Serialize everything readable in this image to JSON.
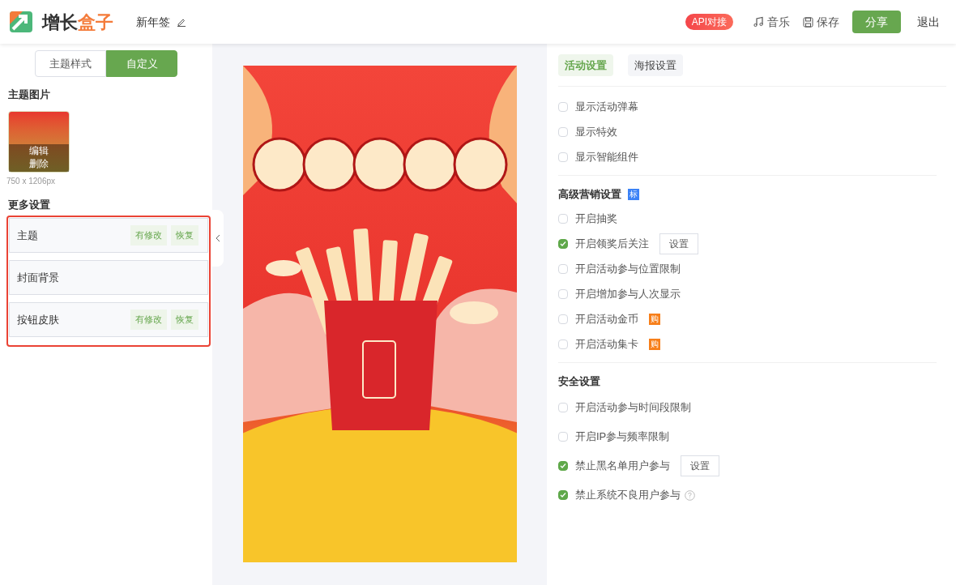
{
  "header": {
    "logo_parts": [
      {
        "text": "增长",
        "color": "#333333"
      },
      {
        "text": "盒子",
        "color": "#f47b3a"
      }
    ],
    "doc_title": "新年签",
    "api_badge": "API对接",
    "actions": [
      {
        "kind": "music",
        "label": "音乐"
      },
      {
        "kind": "save",
        "label": "保存"
      },
      {
        "kind": "primary",
        "label": "分享"
      },
      {
        "kind": "plain",
        "label": "退出"
      }
    ]
  },
  "left": {
    "mode_tabs": [
      {
        "label": "主题样式",
        "selected": false
      },
      {
        "label": "自定义",
        "selected": true
      }
    ],
    "theme_image": {
      "heading": "主题图片",
      "overlay_actions": [
        "编辑",
        "删除"
      ],
      "size": "750 x 1206px"
    },
    "more": {
      "heading": "更多设置",
      "items": [
        {
          "label": "主题",
          "modified": true,
          "modified_label": "有修改",
          "reset_label": "恢复"
        },
        {
          "label": "封面背景",
          "modified": false
        },
        {
          "label": "按钮皮肤",
          "modified": true,
          "modified_label": "有修改",
          "reset_label": "恢复"
        }
      ]
    }
  },
  "right": {
    "tabs": [
      {
        "label": "活动设置",
        "selected": true
      },
      {
        "label": "海报设置",
        "selected": false
      }
    ],
    "sections": [
      {
        "options": [
          {
            "label": "显示活动弹幕",
            "checked": false
          },
          {
            "label": "显示特效",
            "checked": false
          },
          {
            "label": "显示智能组件",
            "checked": false
          }
        ]
      },
      {
        "title": "高级营销设置",
        "title_badge": {
          "text": "标",
          "color": "#3b82f6"
        },
        "options": [
          {
            "label": "开启抽奖",
            "checked": false
          },
          {
            "label": "开启领奖后关注",
            "checked": true,
            "button": "设置"
          },
          {
            "label": "开启活动参与位置限制",
            "checked": false
          },
          {
            "label": "开启增加参与人次显示",
            "checked": false
          },
          {
            "label": "开启活动金币",
            "checked": false,
            "badge": {
              "text": "购",
              "color": "#f77f1a"
            }
          },
          {
            "label": "开启活动集卡",
            "checked": false,
            "badge": {
              "text": "购",
              "color": "#f77f1a"
            }
          }
        ]
      },
      {
        "title": "安全设置",
        "options": [
          {
            "label": "开启活动参与时间段限制",
            "checked": false
          },
          {
            "label": "开启IP参与频率限制",
            "checked": false
          },
          {
            "label": "禁止黑名单用户参与",
            "checked": true,
            "button": "设置"
          },
          {
            "label": "禁止系统不良用户参与",
            "checked": true,
            "help": true
          }
        ]
      }
    ]
  }
}
